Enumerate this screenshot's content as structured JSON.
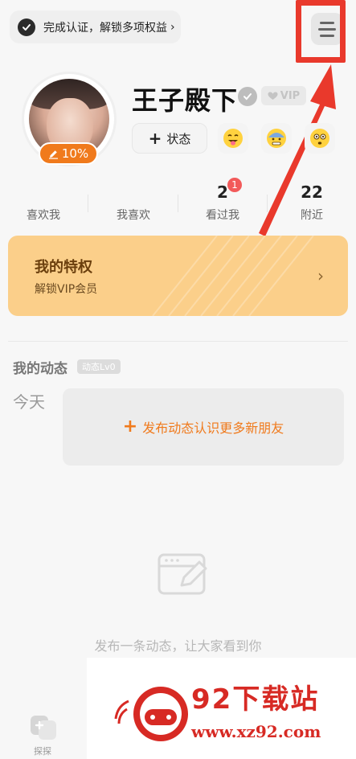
{
  "header": {
    "verify_text": "完成认证，解锁多项权益",
    "verify_chevron": "›",
    "menu_icon": "menu-icon"
  },
  "profile": {
    "avatar_overlay_text": "",
    "progress": "10%",
    "progress_fraction": 0.1,
    "name": "王子殿下",
    "vip_label": "VIP",
    "status_button": "状态",
    "emoji_chips": [
      "😝",
      "😰",
      "😳"
    ]
  },
  "stats": [
    {
      "num": "",
      "label": "喜欢我"
    },
    {
      "num": "",
      "label": "我喜欢"
    },
    {
      "num": "2",
      "label": "看过我",
      "badge": "1"
    },
    {
      "num": "22",
      "label": "附近"
    }
  ],
  "vip_card": {
    "title": "我的特权",
    "subtitle": "解锁VIP会员",
    "color": "#fbcf8a"
  },
  "moments": {
    "title": "我的动态",
    "level": "动态Lv0",
    "day": "今天",
    "post_prompt": "发布动态认识更多新朋友",
    "empty_text": "发布一条动态，让大家看到你"
  },
  "bottom_nav": {
    "explore_label": "探探"
  },
  "watermark": {
    "title": "92下载站",
    "url": "www.xz92.com"
  },
  "colors": {
    "accent": "#f07a1c",
    "highlight_red": "#e9392c",
    "badge_red": "#f25a5a"
  }
}
